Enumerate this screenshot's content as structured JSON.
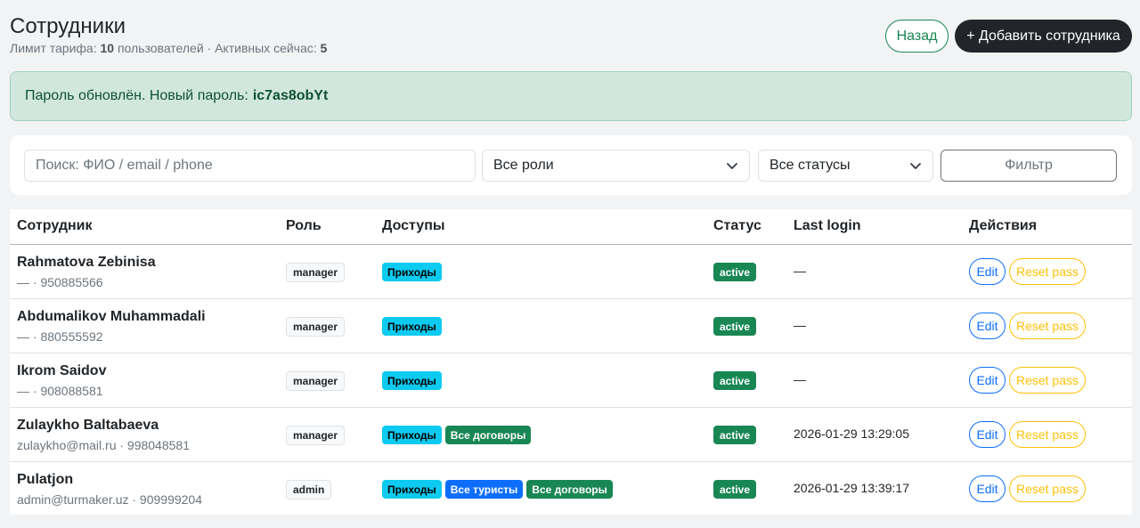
{
  "header": {
    "title": "Сотрудники",
    "subtitle_prefix": "Лимит тарифа: ",
    "limit": "10",
    "subtitle_mid": " пользователей · Активных сейчас: ",
    "active": "5",
    "back_label": "Назад",
    "add_label": "+ Добавить сотрудника"
  },
  "alert": {
    "text": "Пароль обновлён. Новый пароль:",
    "password": "ic7as8obYt"
  },
  "filters": {
    "search_placeholder": "Поиск: ФИО / email / phone",
    "roles_value": "Все роли",
    "status_value": "Все статусы",
    "filter_label": "Фильтр"
  },
  "table": {
    "columns": [
      "Сотрудник",
      "Роль",
      "Доступы",
      "Статус",
      "Last login",
      "Действия"
    ],
    "edit_label": "Edit",
    "reset_label": "Reset pass",
    "rows": [
      {
        "name": "Rahmatova Zebinisa",
        "contact": "— · 950885566",
        "role": "manager",
        "perms": [
          {
            "label": "Приходы",
            "color": "cyan"
          }
        ],
        "status": "active",
        "last_login": "—"
      },
      {
        "name": "Abdumalikov Muhammadali",
        "contact": "— · 880555592",
        "role": "manager",
        "perms": [
          {
            "label": "Приходы",
            "color": "cyan"
          }
        ],
        "status": "active",
        "last_login": "—"
      },
      {
        "name": "Ikrom Saidov",
        "contact": "— · 908088581",
        "role": "manager",
        "perms": [
          {
            "label": "Приходы",
            "color": "cyan"
          }
        ],
        "status": "active",
        "last_login": "—"
      },
      {
        "name": "Zulaykho Baltabaeva",
        "contact": "zulaykho@mail.ru · 998048581",
        "role": "manager",
        "perms": [
          {
            "label": "Приходы",
            "color": "cyan"
          },
          {
            "label": "Все договоры",
            "color": "green"
          }
        ],
        "status": "active",
        "last_login": "2026-01-29 13:29:05"
      },
      {
        "name": "Pulatjon",
        "contact": "admin@turmaker.uz · 909999204",
        "role": "admin",
        "perms": [
          {
            "label": "Приходы",
            "color": "cyan"
          },
          {
            "label": "Все туристы",
            "color": "blue"
          },
          {
            "label": "Все договоры",
            "color": "green"
          }
        ],
        "status": "active",
        "last_login": "2026-01-29 13:39:17"
      }
    ]
  }
}
